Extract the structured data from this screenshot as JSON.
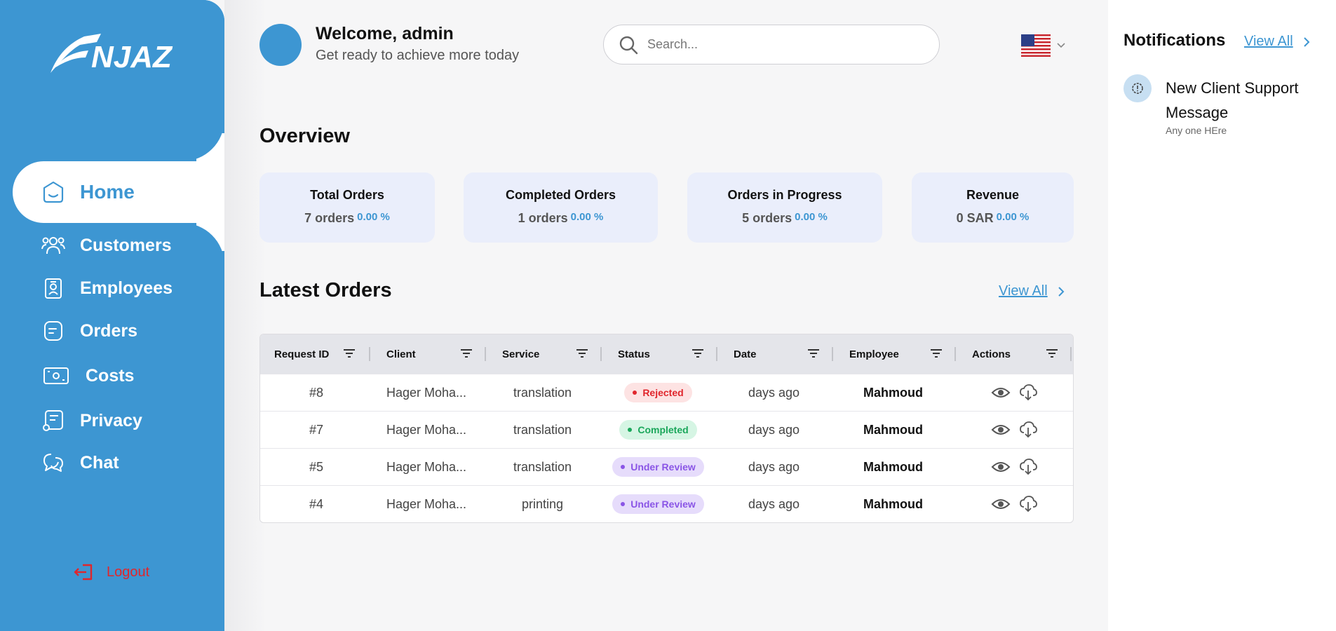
{
  "sidebar": {
    "logo_text": "NJAZ",
    "items": [
      {
        "label": "Home",
        "icon": "home-icon"
      },
      {
        "label": "Customers",
        "icon": "users-icon"
      },
      {
        "label": "Employees",
        "icon": "badge-icon"
      },
      {
        "label": "Orders",
        "icon": "orders-icon"
      },
      {
        "label": "Costs",
        "icon": "money-icon"
      },
      {
        "label": "Privacy",
        "icon": "privacy-icon"
      },
      {
        "label": "Chat",
        "icon": "chat-icon"
      }
    ],
    "logout": "Logout"
  },
  "header": {
    "welcome": "Welcome, admin",
    "subtitle": "Get ready to achieve more today",
    "search_placeholder": "Search..."
  },
  "overview": {
    "title": "Overview",
    "cards": [
      {
        "title": "Total Orders",
        "value": "7 orders",
        "pct": "0.00 %"
      },
      {
        "title": "Completed Orders",
        "value": "1 orders",
        "pct": "0.00 %"
      },
      {
        "title": "Orders in Progress",
        "value": "5 orders",
        "pct": "0.00 %"
      },
      {
        "title": "Revenue",
        "value": "0 SAR",
        "pct": "0.00 %"
      }
    ]
  },
  "latest": {
    "title": "Latest Orders",
    "view_all": "View All",
    "columns": [
      "Request ID",
      "Client",
      "Service",
      "Status",
      "Date",
      "Employee",
      "Actions"
    ],
    "rows": [
      {
        "id": "#8",
        "client": "Hager Moha...",
        "service": "translation",
        "status": "Rejected",
        "date": "days ago",
        "employee": "Mahmoud"
      },
      {
        "id": "#7",
        "client": "Hager Moha...",
        "service": "translation",
        "status": "Completed",
        "date": "days ago",
        "employee": "Mahmoud"
      },
      {
        "id": "#5",
        "client": "Hager Moha...",
        "service": "translation",
        "status": "Under Review",
        "date": "days ago",
        "employee": "Mahmoud"
      },
      {
        "id": "#4",
        "client": "Hager Moha...",
        "service": "printing",
        "status": "Under Review",
        "date": "days ago",
        "employee": "Mahmoud"
      }
    ]
  },
  "status_colors": {
    "Rejected": {
      "bg": "#fde3e3",
      "fg": "#e0262c"
    },
    "Completed": {
      "bg": "#d6f5e4",
      "fg": "#1ba75b"
    },
    "Under Review": {
      "bg": "#e6dcfb",
      "fg": "#8a55e6"
    }
  },
  "notifications": {
    "title": "Notifications",
    "view_all": "View All",
    "items": [
      {
        "title": "New Client Support Message",
        "subtitle": "Any one HEre"
      }
    ]
  },
  "colors": {
    "accent": "#3d96d2",
    "danger": "#e0262c"
  }
}
